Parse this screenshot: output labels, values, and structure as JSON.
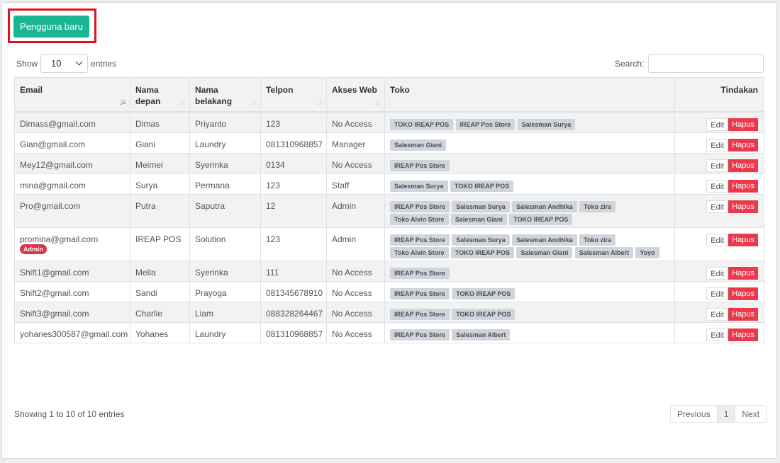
{
  "toolbar": {
    "new_label": "Pengguna baru"
  },
  "length": {
    "show": "Show",
    "value": "10",
    "entries": "entries"
  },
  "search": {
    "label": "Search:",
    "value": ""
  },
  "columns": [
    "Email",
    "Nama depan",
    "Nama belakang",
    "Telpon",
    "Akses Web",
    "Toko",
    "Tindakan"
  ],
  "actions": {
    "edit": "Edit",
    "delete": "Hapus"
  },
  "rows": [
    {
      "email": "Dimass@gmail.com",
      "first": "Dimas",
      "last": "Priyanto",
      "phone": "123",
      "access": "No Access",
      "stores": [
        "TOKO IREAP POS",
        "IREAP Pos Store",
        "Salesman Surya"
      ]
    },
    {
      "email": "Gian@gmail.com",
      "first": "Giani",
      "last": "Laundry",
      "phone": "081310968857",
      "access": "Manager",
      "stores": [
        "Salesman Giani"
      ]
    },
    {
      "email": "Mey12@gmail.com",
      "first": "Meimei",
      "last": "Syerinka",
      "phone": "0134",
      "access": "No Access",
      "stores": [
        "IREAP Pos Store"
      ]
    },
    {
      "email": "mina@gmail.com",
      "first": "Surya",
      "last": "Permana",
      "phone": "123",
      "access": "Staff",
      "stores": [
        "Salesman Surya",
        "TOKO IREAP POS"
      ]
    },
    {
      "email": "Pro@gmail.com",
      "first": "Putra",
      "last": "Saputra",
      "phone": "12",
      "access": "Admin",
      "stores": [
        "IREAP Pos Store",
        "Salesman Surya",
        "Salesman Andhika",
        "Toko zira",
        "Toko Alvin Store",
        "Salesman Giani",
        "TOKO IREAP POS"
      ]
    },
    {
      "email": "promina@gmail.com",
      "badge": "Admin",
      "first": "IREAP POS",
      "last": "Solution",
      "phone": "123",
      "access": "Admin",
      "stores": [
        "IREAP Pos Store",
        "Salesman Surya",
        "Salesman Andhika",
        "Toko zira",
        "Toko Alvin Store",
        "TOKO IREAP POS",
        "Salesman Giani",
        "Salesman Albert",
        "Yoyo"
      ]
    },
    {
      "email": "Shift1@gmail.com",
      "first": "Mella",
      "last": "Syerinka",
      "phone": "111",
      "access": "No Access",
      "stores": [
        "IREAP Pos Store"
      ]
    },
    {
      "email": "Shift2@gmail.com",
      "first": "Sandi",
      "last": "Prayoga",
      "phone": "081345678910",
      "access": "No Access",
      "stores": [
        "IREAP Pos Store",
        "TOKO IREAP POS"
      ]
    },
    {
      "email": "Shift3@gmail.com",
      "first": "Charlie",
      "last": "Liam",
      "phone": "088328264467",
      "access": "No Access",
      "stores": [
        "IREAP Pos Store",
        "TOKO IREAP POS"
      ]
    },
    {
      "email": "yohanes300587@gmail.com",
      "first": "Yohanes",
      "last": "Laundry",
      "phone": "081310968857",
      "access": "No Access",
      "stores": [
        "IREAP Pos Store",
        "Salesman Albert"
      ]
    }
  ],
  "footer": {
    "info": "Showing 1 to 10 of 10 entries",
    "previous": "Previous",
    "page": "1",
    "next": "Next"
  }
}
